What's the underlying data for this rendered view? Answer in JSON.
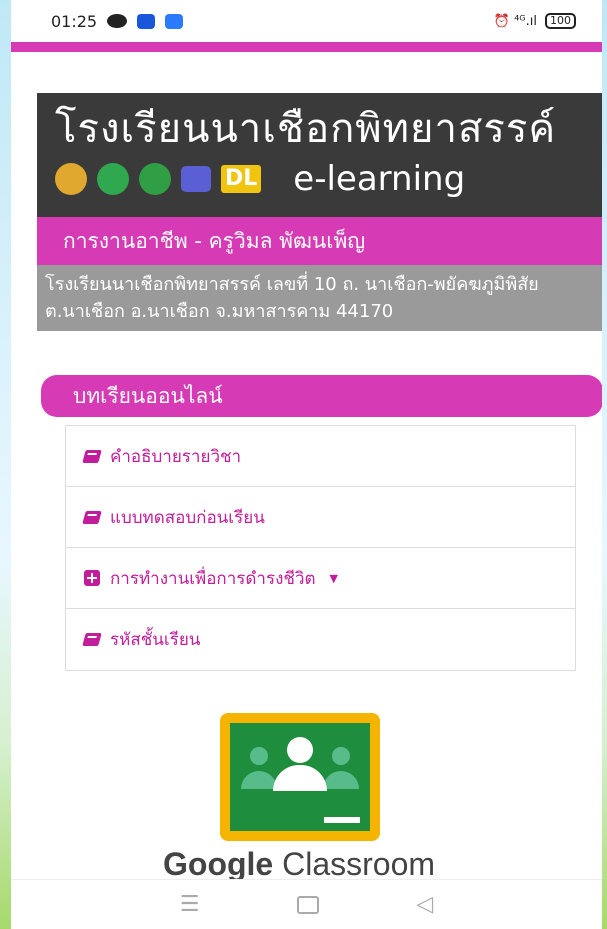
{
  "status_bar": {
    "time": "01:25",
    "right_text": "⏰ ⁴ᴳ.ıl",
    "battery": "100"
  },
  "banner": {
    "title": "โรงเรียนนาเชือกพิทยาสรรค์",
    "badge": "DL",
    "tagline": "e-learning"
  },
  "header": {
    "subtitle": "การงานอาชีพ - ครูวิมล พัฒนเพ็ญ",
    "address": "โรงเรียนนาเชือกพิทยาสรรค์ เลขที่ 10 ถ. นาเชือก-พยัคฆภูมิพิสัย ต.นาเชือก อ.นาเชือก จ.มหาสารคาม 44170"
  },
  "online": {
    "heading": "บทเรียนออนไลน์",
    "items": [
      {
        "label": "คำอธิบายรายวิชา",
        "icon": "book-icon"
      },
      {
        "label": "แบบทดสอบก่อนเรียน",
        "icon": "book-icon"
      },
      {
        "label": "การทำงานเพื่อการดำรงชีวิต",
        "icon": "plus-icon",
        "caret": "▼"
      },
      {
        "label": "รหัสชั้นเรียน",
        "icon": "book-icon"
      }
    ]
  },
  "classroom": {
    "brand_bold": "Google",
    "brand_rest": " Classroom"
  },
  "colors": {
    "accent": "#d63ab4",
    "link": "#c21d9a",
    "banner_bg": "#3a3a3a",
    "address_bg": "#9a9a9a"
  },
  "nav": {
    "menu": "☰",
    "back": "◁"
  }
}
